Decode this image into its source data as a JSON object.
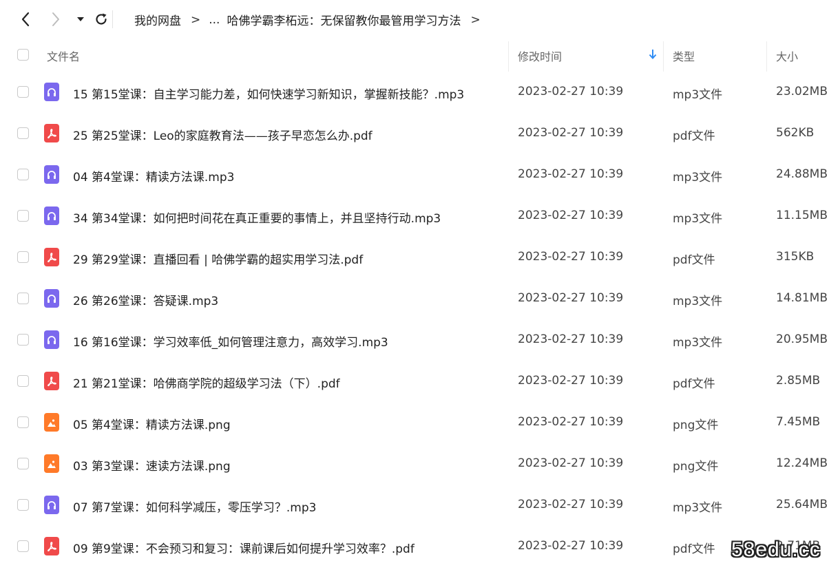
{
  "breadcrumb": {
    "items": [
      "我的网盘",
      "...",
      "哈佛学霸李柘远：无保留教你最管用学习方法"
    ],
    "separator": ">"
  },
  "columns": {
    "name": "文件名",
    "modified": "修改时间",
    "type": "类型",
    "size": "大小"
  },
  "colors": {
    "audio": "#7b68ee",
    "pdf": "#f04a4a",
    "image": "#ff7a29",
    "sort_arrow": "#2f8cf4"
  },
  "files": [
    {
      "name": "15 第15堂课：自主学习能力差，如何快速学习新知识，掌握新技能？.mp3",
      "time": "2023-02-27 10:39",
      "type": "mp3文件",
      "size": "23.02MB",
      "icon": "audio-icon"
    },
    {
      "name": "25 第25堂课：Leo的家庭教育法——孩子早恋怎么办.pdf",
      "time": "2023-02-27 10:39",
      "type": "pdf文件",
      "size": "562KB",
      "icon": "pdf-icon"
    },
    {
      "name": "04 第4堂课：精读方法课.mp3",
      "time": "2023-02-27 10:39",
      "type": "mp3文件",
      "size": "24.88MB",
      "icon": "audio-icon"
    },
    {
      "name": "34 第34堂课：如何把时间花在真正重要的事情上，并且坚持行动.mp3",
      "time": "2023-02-27 10:39",
      "type": "mp3文件",
      "size": "11.15MB",
      "icon": "audio-icon"
    },
    {
      "name": "29 第29堂课：直播回看 | 哈佛学霸的超实用学习法.pdf",
      "time": "2023-02-27 10:39",
      "type": "pdf文件",
      "size": "315KB",
      "icon": "pdf-icon"
    },
    {
      "name": "26 第26堂课：答疑课.mp3",
      "time": "2023-02-27 10:39",
      "type": "mp3文件",
      "size": "14.81MB",
      "icon": "audio-icon"
    },
    {
      "name": "16 第16堂课：学习效率低_如何管理注意力，高效学习.mp3",
      "time": "2023-02-27 10:39",
      "type": "mp3文件",
      "size": "20.95MB",
      "icon": "audio-icon"
    },
    {
      "name": "21 第21堂课：哈佛商学院的超级学习法（下）.pdf",
      "time": "2023-02-27 10:39",
      "type": "pdf文件",
      "size": "2.85MB",
      "icon": "pdf-icon"
    },
    {
      "name": "05 第4堂课：精读方法课.png",
      "time": "2023-02-27 10:39",
      "type": "png文件",
      "size": "7.45MB",
      "icon": "image-icon"
    },
    {
      "name": "03 第3堂课：速读方法课.png",
      "time": "2023-02-27 10:39",
      "type": "png文件",
      "size": "12.24MB",
      "icon": "image-icon"
    },
    {
      "name": "07 第7堂课：如何科学减压，零压学习？.mp3",
      "time": "2023-02-27 10:39",
      "type": "mp3文件",
      "size": "25.64MB",
      "icon": "audio-icon"
    },
    {
      "name": "09 第9堂课：不会预习和复习：课前课后如何提升学习效率？.pdf",
      "time": "2023-02-27 10:39",
      "type": "pdf文件",
      "size": "2.71MB",
      "icon": "pdf-icon"
    }
  ],
  "watermark": "58edu.cc"
}
